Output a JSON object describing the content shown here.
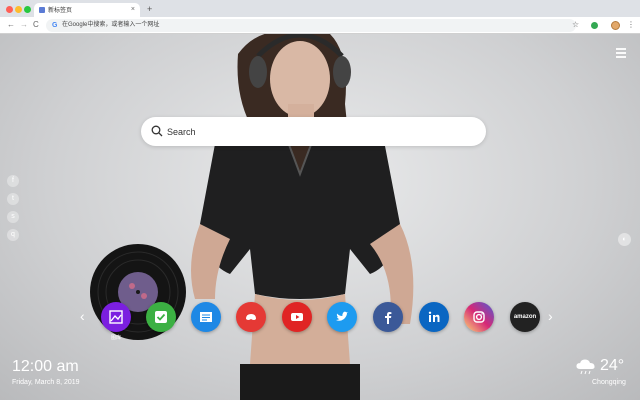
{
  "window": {
    "tab_title": "新标签页",
    "tab_close": "×",
    "new_tab": "+"
  },
  "toolbar": {
    "back": "←",
    "forward": "→",
    "reload": "C",
    "omnibox_text": "在Google中搜索，或者输入一个网址",
    "star": "☆",
    "menu": "⋮"
  },
  "search": {
    "placeholder": "Search",
    "icon": "search-icon"
  },
  "social_left": [
    {
      "name": "facebook",
      "glyph": "f"
    },
    {
      "name": "twitter",
      "glyph": "t"
    },
    {
      "name": "share",
      "glyph": "s"
    },
    {
      "name": "search",
      "glyph": "q"
    }
  ],
  "nav_arrows": {
    "left": "‹",
    "right": "›"
  },
  "speed_dials": [
    {
      "name": "gallery",
      "label": "图库",
      "color": "#7b1fe0"
    },
    {
      "name": "check",
      "label": "",
      "color": "#3cb043"
    },
    {
      "name": "notes",
      "label": "",
      "color": "#1e88e5"
    },
    {
      "name": "game",
      "label": "",
      "color": "#e53935"
    },
    {
      "name": "youtube",
      "label": "",
      "color": "#e02424"
    },
    {
      "name": "twitter",
      "label": "",
      "color": "#1d9bf0"
    },
    {
      "name": "facebook",
      "label": "",
      "color": "#3b5998"
    },
    {
      "name": "linkedin",
      "label": "",
      "color": "#0a66c2"
    },
    {
      "name": "instagram",
      "label": "",
      "color": "#d62976"
    },
    {
      "name": "amazon",
      "label": "amazon",
      "color": "#222222"
    }
  ],
  "clock": {
    "time": "12:00 am",
    "date": "Friday, March 8, 2019"
  },
  "weather": {
    "temp": "24°",
    "city": "Chongqing",
    "icon": "cloud-rain-icon"
  },
  "colors": {
    "accent": "#ffffff",
    "chrome_bg": "#dee1e6"
  }
}
